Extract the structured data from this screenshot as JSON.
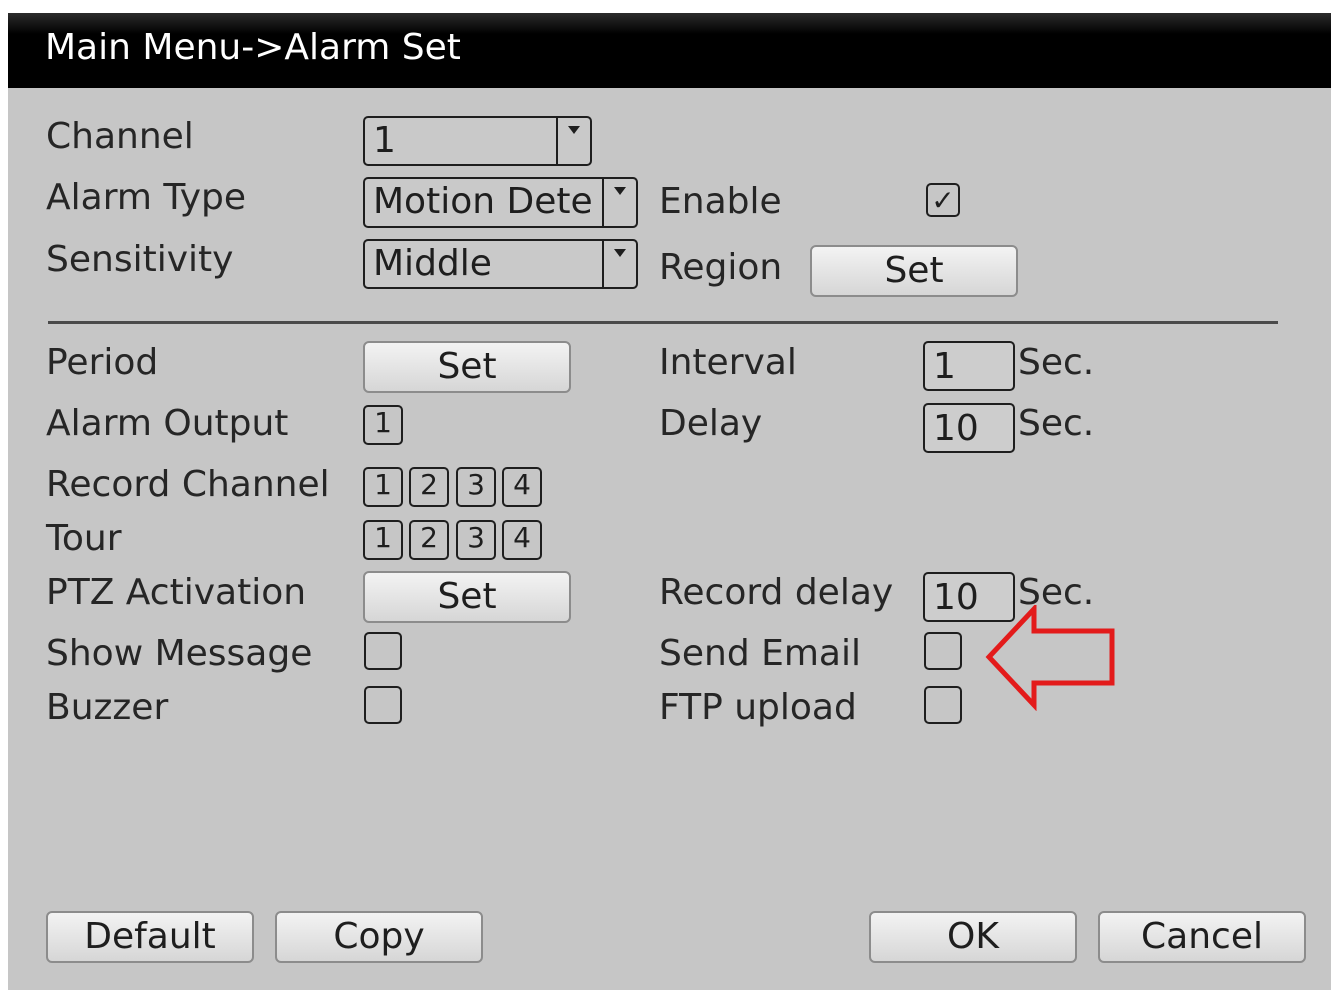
{
  "title": "Main Menu->Alarm Set",
  "labels": {
    "channel": "Channel",
    "alarm_type": "Alarm Type",
    "sensitivity": "Sensitivity",
    "enable": "Enable",
    "region": "Region",
    "period": "Period",
    "alarm_output": "Alarm Output",
    "record_channel": "Record Channel",
    "tour": "Tour",
    "ptz_activation": "PTZ Activation",
    "show_message": "Show Message",
    "buzzer": "Buzzer",
    "interval": "Interval",
    "delay": "Delay",
    "record_delay": "Record delay",
    "send_email": "Send Email",
    "ftp_upload": "FTP upload",
    "sec": "Sec."
  },
  "values": {
    "channel": "1",
    "alarm_type": "Motion Dete",
    "sensitivity": "Middle",
    "interval": "1",
    "delay": "10",
    "record_delay": "10"
  },
  "checkboxes": {
    "enable": true,
    "show_message": false,
    "buzzer": false,
    "send_email": false,
    "ftp_upload": false
  },
  "alarm_output_channels": [
    "1"
  ],
  "record_channels": [
    "1",
    "2",
    "3",
    "4"
  ],
  "tour_channels": [
    "1",
    "2",
    "3",
    "4"
  ],
  "buttons": {
    "set": "Set",
    "default": "Default",
    "copy": "Copy",
    "ok": "OK",
    "cancel": "Cancel"
  },
  "icons": {
    "enable_check": "✓",
    "dropdown": "chevron-down-icon",
    "annotation": "left-arrow-icon"
  },
  "colors": {
    "annotation_arrow": "#e31b1b",
    "title_bar": "#000000",
    "window_bg": "#c6c6c6"
  }
}
